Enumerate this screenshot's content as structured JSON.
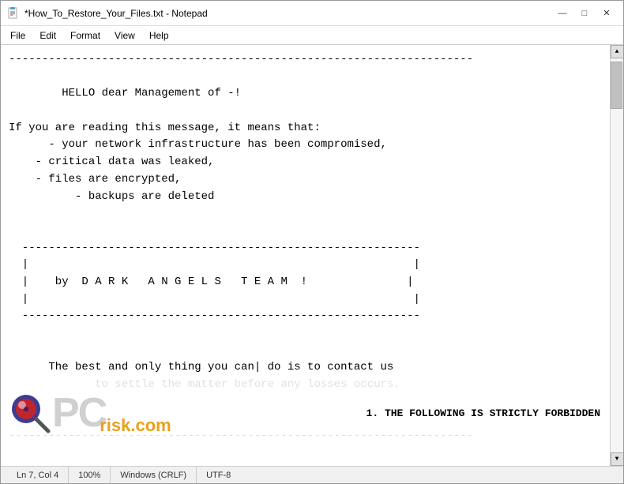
{
  "window": {
    "title": "*How_To_Restore_Your_Files.txt - Notepad"
  },
  "titlebar": {
    "minimize_label": "—",
    "maximize_label": "□",
    "close_label": "✕"
  },
  "menubar": {
    "items": [
      {
        "id": "file",
        "label": "File"
      },
      {
        "id": "edit",
        "label": "Edit"
      },
      {
        "id": "format",
        "label": "Format"
      },
      {
        "id": "view",
        "label": "View"
      },
      {
        "id": "help",
        "label": "Help"
      }
    ]
  },
  "editor": {
    "content": "----------------------------------------------------------------------\n\n        HELLO dear Management of -!\n\nIf you are reading this message, it means that:\n      - your network infrastructure has been compromised,\n    - critical data was leaked,\n    - files are encrypted,\n          - backups are deleted\n\n\n  ------------------------------------------------------------\n  |                                                          |\n  |    by  D A R K   A N G E L S   T E A M  !               |\n  |                                                          |\n  ------------------------------------------------------------\n\n\n      The best and only thing you can| do is to contact us\n             to settle the matter before any losses occurs.\n\n\n----------------------------------------------------------------------\n\n"
  },
  "statusbar": {
    "position": "Ln 7, Col 4",
    "zoom": "100%",
    "line_endings": "Windows (CRLF)",
    "encoding": "UTF-8"
  },
  "watermark": {
    "forbidden_text": "1. THE FOLLOWING IS STRICTLY FORBIDDEN",
    "pc_letters": "PC",
    "risk_text": "risk.com"
  }
}
